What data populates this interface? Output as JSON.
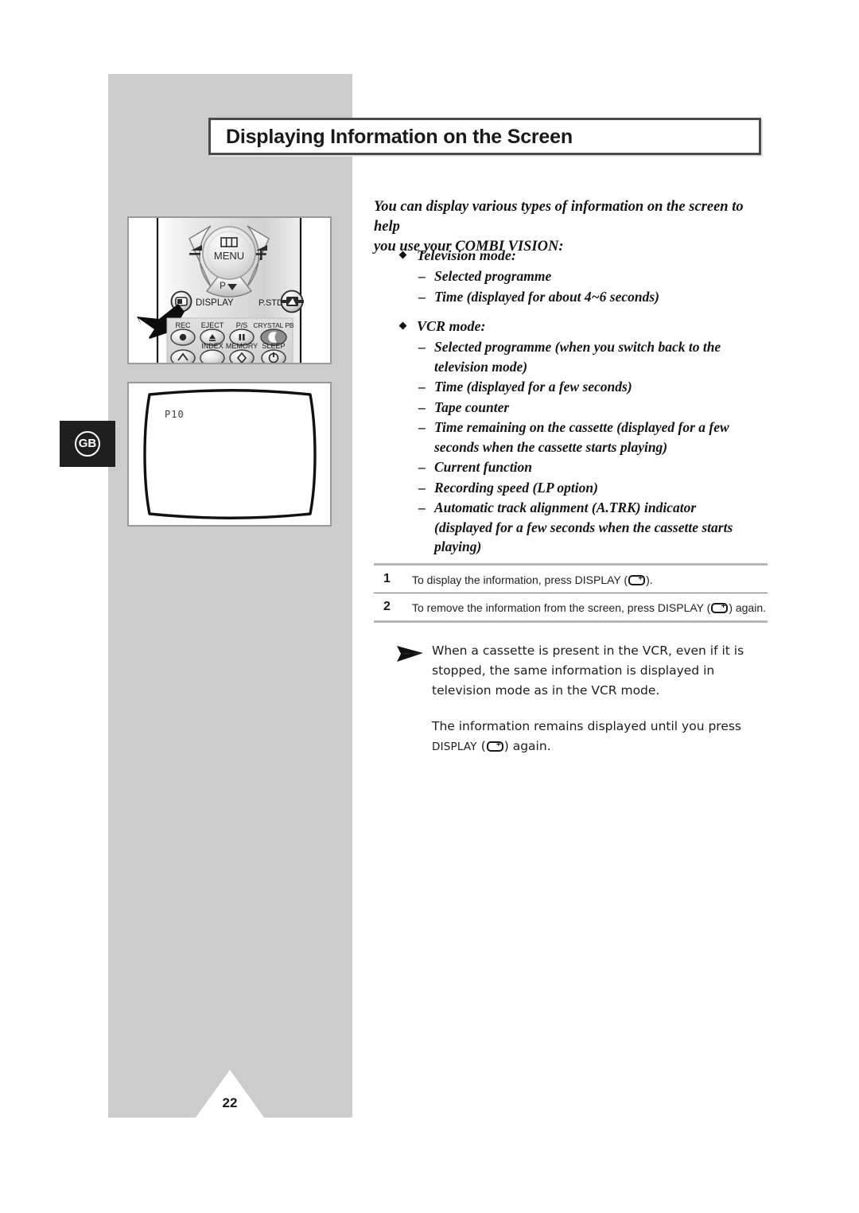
{
  "page": {
    "number": "22",
    "language_tab": "GB",
    "title": "Displaying Information on the Screen"
  },
  "intro": {
    "line1": "You can display various types of information on the screen to help",
    "line2": "you use your COMBI VISION:"
  },
  "bullets": [
    {
      "head": "Television mode:",
      "items": [
        {
          "line1": "Selected programme",
          "line2": ""
        },
        {
          "line1": "Time (displayed for about 4~6 seconds)",
          "line2": ""
        }
      ]
    },
    {
      "head": "VCR mode:",
      "items": [
        {
          "line1": "Selected programme (when you switch back to the",
          "line2": "television mode)"
        },
        {
          "line1": "Time (displayed for a few seconds)",
          "line2": ""
        },
        {
          "line1": "Tape counter",
          "line2": ""
        },
        {
          "line1": "Time remaining on the cassette (displayed for a few",
          "line2": "seconds when the cassette starts playing)"
        },
        {
          "line1": "Current function",
          "line2": ""
        },
        {
          "line1": "Recording speed (LP option)",
          "line2": ""
        },
        {
          "line1": "Automatic track alignment (A.TRK) indicator",
          "line2": "(displayed for a few seconds when the cassette starts",
          "line3": "playing)"
        }
      ]
    }
  ],
  "bullet_marker": {
    "diamond": "◆",
    "dash": "–"
  },
  "steps": [
    {
      "number": "1",
      "before": "To display the information, press DISPLAY (",
      "after": ")."
    },
    {
      "number": "2",
      "before": "To remove the information from the screen, press DISPLAY (",
      "after": ") again."
    }
  ],
  "note": {
    "paragraph1": "When a cassette is present in the VCR, even if it is stopped, the same information is displayed in television mode as in the VCR mode.",
    "paragraph2_before": "The information remains displayed until you press ",
    "paragraph2_caps": "DISPLAY",
    "paragraph2_mid": " (",
    "paragraph2_after": ") again."
  },
  "figures": {
    "remote": {
      "menu_label": "MENU",
      "volume_down": "–",
      "volume_up": "+",
      "programme_down": "P ▼",
      "display_label": "DISPLAY",
      "pstd_label": "P.STD",
      "buttons_row1": [
        "REC",
        "EJECT",
        "P/S",
        "CRYSTAL PB"
      ],
      "buttons_row2": [
        "",
        "INDEX",
        "MEMORY",
        "SLEEP"
      ]
    },
    "tv_screen": {
      "osd_text": "P10"
    }
  },
  "colors": {
    "band_gray": "#cccccc",
    "tab_black": "#201f1f",
    "rule_gray": "#b6b6b6",
    "text": "#151515"
  }
}
